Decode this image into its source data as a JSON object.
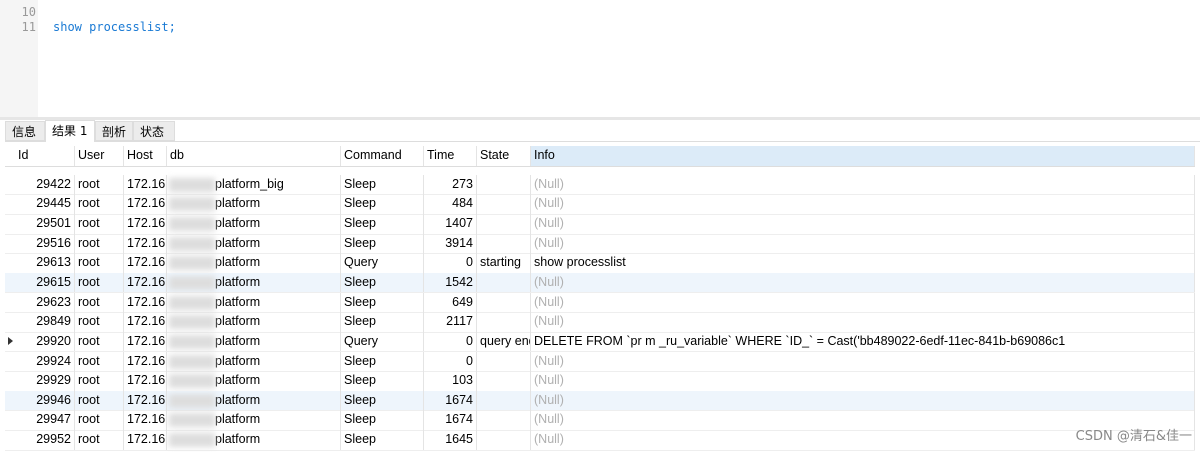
{
  "editor": {
    "lines": [
      "10",
      "11"
    ],
    "code": "show processlist;"
  },
  "tabs": [
    "信息",
    "结果 1",
    "剖析",
    "状态"
  ],
  "columns": [
    "Id",
    "User",
    "Host",
    "db",
    "Command",
    "Time",
    "State",
    "Info"
  ],
  "rows": [
    [
      "29422",
      "root",
      "172.16.",
      "platform_big",
      "Sleep",
      "273",
      "",
      "(Null)"
    ],
    [
      "29445",
      "root",
      "172.16",
      "platform",
      "Sleep",
      "484",
      "",
      "(Null)"
    ],
    [
      "29501",
      "root",
      "172.16.",
      "platform",
      "Sleep",
      "1407",
      "",
      "(Null)"
    ],
    [
      "29516",
      "root",
      "172.16.",
      "platform",
      "Sleep",
      "3914",
      "",
      "(Null)"
    ],
    [
      "29613",
      "root",
      "172.16.",
      "platform",
      "Query",
      "0",
      "starting",
      "show processlist"
    ],
    [
      "29615",
      "root",
      "172.16.",
      "platform",
      "Sleep",
      "1542",
      "",
      "(Null)"
    ],
    [
      "29623",
      "root",
      "172.16.",
      "platform",
      "Sleep",
      "649",
      "",
      "(Null)"
    ],
    [
      "29849",
      "root",
      "172.16.",
      "platform",
      "Sleep",
      "2117",
      "",
      "(Null)"
    ],
    [
      "29920",
      "root",
      "172.16",
      "platform",
      "Query",
      "0",
      "query end",
      "DELETE FROM `pr              m  _ru_variable` WHERE `ID_` = Cast('bb489022-6edf-11ec-841b-b69086c1"
    ],
    [
      "29924",
      "root",
      "172.16.",
      "platform",
      "Sleep",
      "0",
      "",
      "(Null)"
    ],
    [
      "29929",
      "root",
      "172.16.",
      "platform",
      "Sleep",
      "103",
      "",
      "(Null)"
    ],
    [
      "29946",
      "root",
      "172.16.",
      "platform",
      "Sleep",
      "1674",
      "",
      "(Null)"
    ],
    [
      "29947",
      "root",
      "172.16",
      "platform",
      "Sleep",
      "1674",
      "",
      "(Null)"
    ],
    [
      "29952",
      "root",
      "172.16.",
      "platform",
      "Sleep",
      "1645",
      "",
      "(Null)"
    ]
  ],
  "selected_row": 8,
  "highlight_rows": [
    5,
    11
  ],
  "watermark": "CSDN @清石&佳一"
}
